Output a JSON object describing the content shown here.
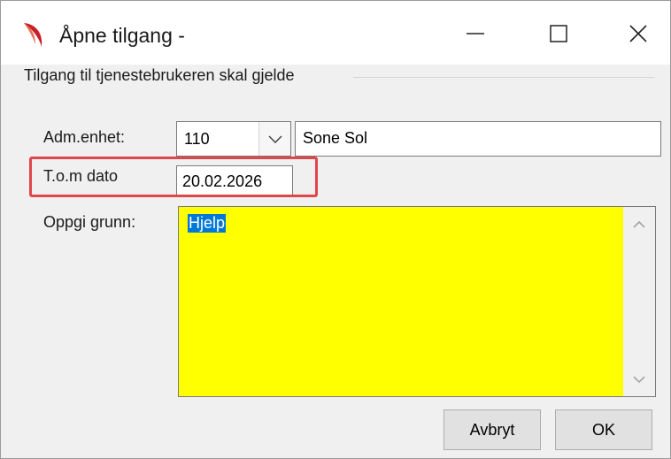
{
  "window": {
    "title": "Åpne tilgang -",
    "controls": {
      "minimize": "minimize-icon",
      "maximize": "maximize-icon",
      "close": "close-icon"
    }
  },
  "group": {
    "label": "Tilgang til tjenestebrukeren skal gjelde"
  },
  "form": {
    "adm_enhet_label": "Adm.enhet:",
    "adm_enhet_code": "110",
    "adm_enhet_name": "Sone Sol",
    "tom_dato_label": "T.o.m dato",
    "tom_dato_value": "20.02.2026",
    "grunn_label": "Oppgi grunn:",
    "grunn_value": "Hjelp"
  },
  "buttons": {
    "cancel": "Avbryt",
    "ok": "OK"
  },
  "colors": {
    "reason_background": "#ffff00",
    "highlight": "#e0464a",
    "selection": "#0078d7"
  }
}
